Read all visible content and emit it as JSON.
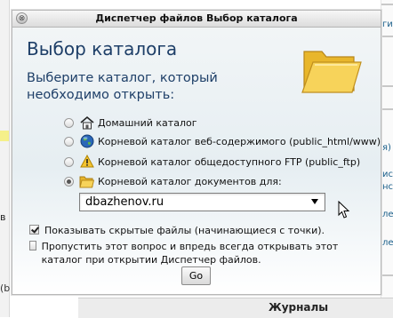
{
  "background": {
    "right_fragments": [
      "гиф",
      "я)",
      "иск",
      "нс",
      "ле",
      "ле"
    ],
    "bottom_left": "(bu",
    "bottom_label": "Журналы"
  },
  "dialog": {
    "title": "Диспетчер файлов Выбор каталога",
    "close_glyph": "⊗",
    "heading": "Выбор каталога",
    "question": "Выберите каталог, который необходимо открыть:",
    "options": [
      {
        "label": "Домашний каталог",
        "icon": "home-icon",
        "selected": false
      },
      {
        "label": "Корневой каталог веб-содержимого (public_html/www)",
        "icon": "globe-icon",
        "selected": false
      },
      {
        "label": "Корневой каталог общедоступного FTP (public_ftp)",
        "icon": "ftp-warning-icon",
        "selected": false
      },
      {
        "label": "Корневой каталог документов для:",
        "icon": "folder-icon",
        "selected": true
      }
    ],
    "domain_select": {
      "value": "dbazhenov.ru"
    },
    "show_hidden": {
      "label": "Показывать скрытые файлы (начинающиеся с точки).",
      "checked": true
    },
    "skip_question": {
      "label": "Пропустить этот вопрос и впредь всегда открывать этот каталог при открытии Диспетчер файлов.",
      "checked": false
    },
    "go_label": "Go"
  },
  "colors": {
    "heading": "#1e3f68",
    "folder": "#f5c842"
  }
}
